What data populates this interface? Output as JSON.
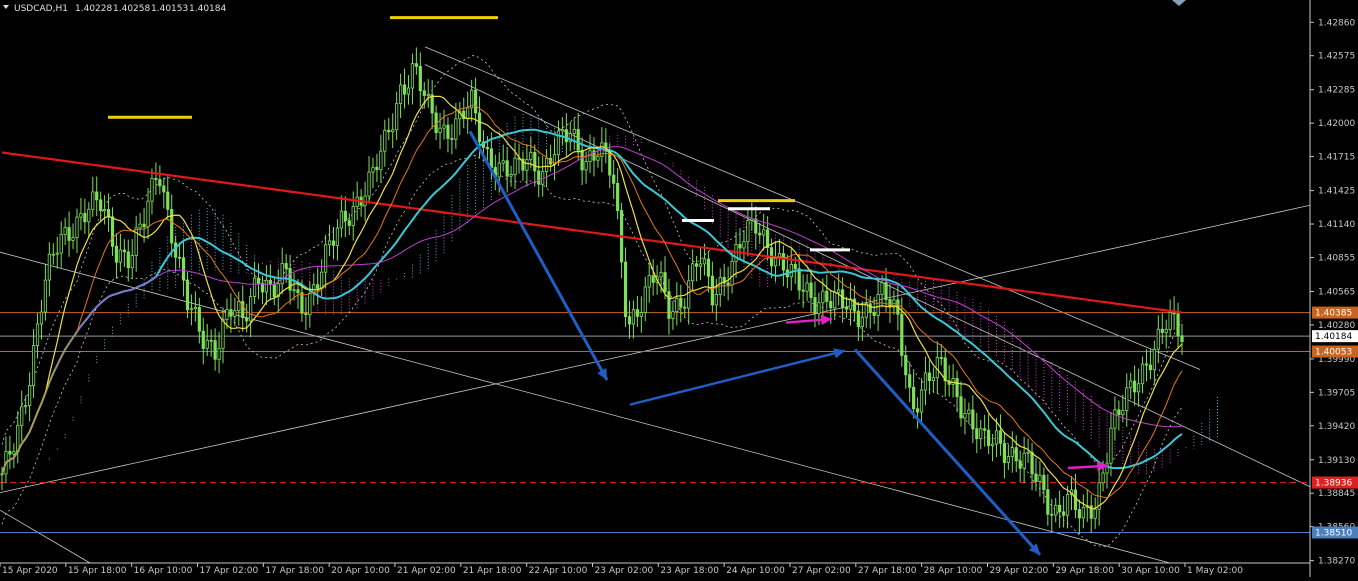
{
  "chart_data": {
    "type": "candlestick",
    "symbol": "USDCAD,H1",
    "ohlc": [
      "1.40228",
      "1.40258",
      "1.40153",
      "1.40184"
    ],
    "ylim": [
      1.3825,
      1.4305
    ],
    "y_ticks": [
      "1.42860",
      "1.42575",
      "1.42285",
      "1.42000",
      "1.41715",
      "1.41425",
      "1.41140",
      "1.40855",
      "1.40565",
      "1.40280",
      "1.39990",
      "1.39705",
      "1.39420",
      "1.39130",
      "1.38845",
      "1.38560",
      "1.38270"
    ],
    "x_ticks": [
      "15 Apr 2020",
      "15 Apr 18:00",
      "16 Apr 10:00",
      "17 Apr 02:00",
      "17 Apr 18:00",
      "20 Apr 10:00",
      "21 Apr 02:00",
      "21 Apr 18:00",
      "22 Apr 10:00",
      "23 Apr 02:00",
      "23 Apr 18:00",
      "24 Apr 10:00",
      "27 Apr 02:00",
      "27 Apr 18:00",
      "28 Apr 10:00",
      "29 Apr 02:00",
      "29 Apr 18:00",
      "30 Apr 10:00",
      "1 May 02:00"
    ],
    "price_tags": [
      {
        "label": "1.40385",
        "value": 1.40385,
        "color": "#c8641e"
      },
      {
        "label": "1.40184",
        "value": 1.40184,
        "color": "#ffffff"
      },
      {
        "label": "1.40053",
        "value": 1.40053,
        "color": "#c8641e"
      },
      {
        "label": "1.38936",
        "value": 1.38936,
        "color": "#e02020"
      },
      {
        "label": "1.38510",
        "value": 1.3851,
        "color": "#4a7fc0"
      }
    ],
    "horizontal_lines": [
      {
        "value": 1.40385,
        "color": "#c8641e",
        "style": "solid"
      },
      {
        "value": 1.40184,
        "color": "#9a9a9a",
        "style": "solid"
      },
      {
        "value": 1.40053,
        "color": "#c8641e",
        "style": "solid"
      },
      {
        "value": 1.38936,
        "color": "#e02020",
        "style": "dashed"
      },
      {
        "value": 1.3851,
        "color": "#4a7fc0",
        "style": "solid"
      }
    ],
    "close_series": [
      1.3895,
      1.3935,
      1.399,
      1.406,
      1.41,
      1.4115,
      1.4125,
      1.413,
      1.4095,
      1.4085,
      1.4115,
      1.4165,
      1.4105,
      1.4045,
      1.402,
      1.401,
      1.404,
      1.403,
      1.4075,
      1.4055,
      1.407,
      1.4045,
      1.406,
      1.409,
      1.412,
      1.4135,
      1.415,
      1.4185,
      1.423,
      1.4245,
      1.421,
      1.4195,
      1.42,
      1.4215,
      1.4175,
      1.4165,
      1.4155,
      1.417,
      1.416,
      1.418,
      1.419,
      1.417,
      1.418,
      1.415,
      1.403,
      1.405,
      1.407,
      1.404,
      1.4055,
      1.4085,
      1.405,
      1.4075,
      1.41,
      1.411,
      1.4095,
      1.408,
      1.406,
      1.405,
      1.4055,
      1.4045,
      1.4035,
      1.4045,
      1.4055,
      1.403,
      1.396,
      1.398,
      1.399,
      1.3975,
      1.395,
      1.3925,
      1.393,
      1.392,
      1.391,
      1.389,
      1.387,
      1.388,
      1.386,
      1.388,
      1.394,
      1.396,
      1.3985,
      1.401,
      1.403,
      1.4018
    ],
    "colors": {
      "background": "#000000",
      "candle": "#7ee05a",
      "ma_red": "#e01818",
      "ma_cyan": "#38c8d8",
      "ma_magenta": "#c040d0",
      "ma_yellow": "#f0e040",
      "ma_orange": "#e07818",
      "envelope": "#c8c8c8",
      "cloud_up": "#4ab8d8",
      "cloud_down": "#d040d0",
      "arrow_blue": "#1f5ec4",
      "arrow_magenta": "#e020c8",
      "marker_yellow": "#f0d000",
      "marker_white": "#ffffff",
      "channel": "#c8c8c8"
    }
  }
}
